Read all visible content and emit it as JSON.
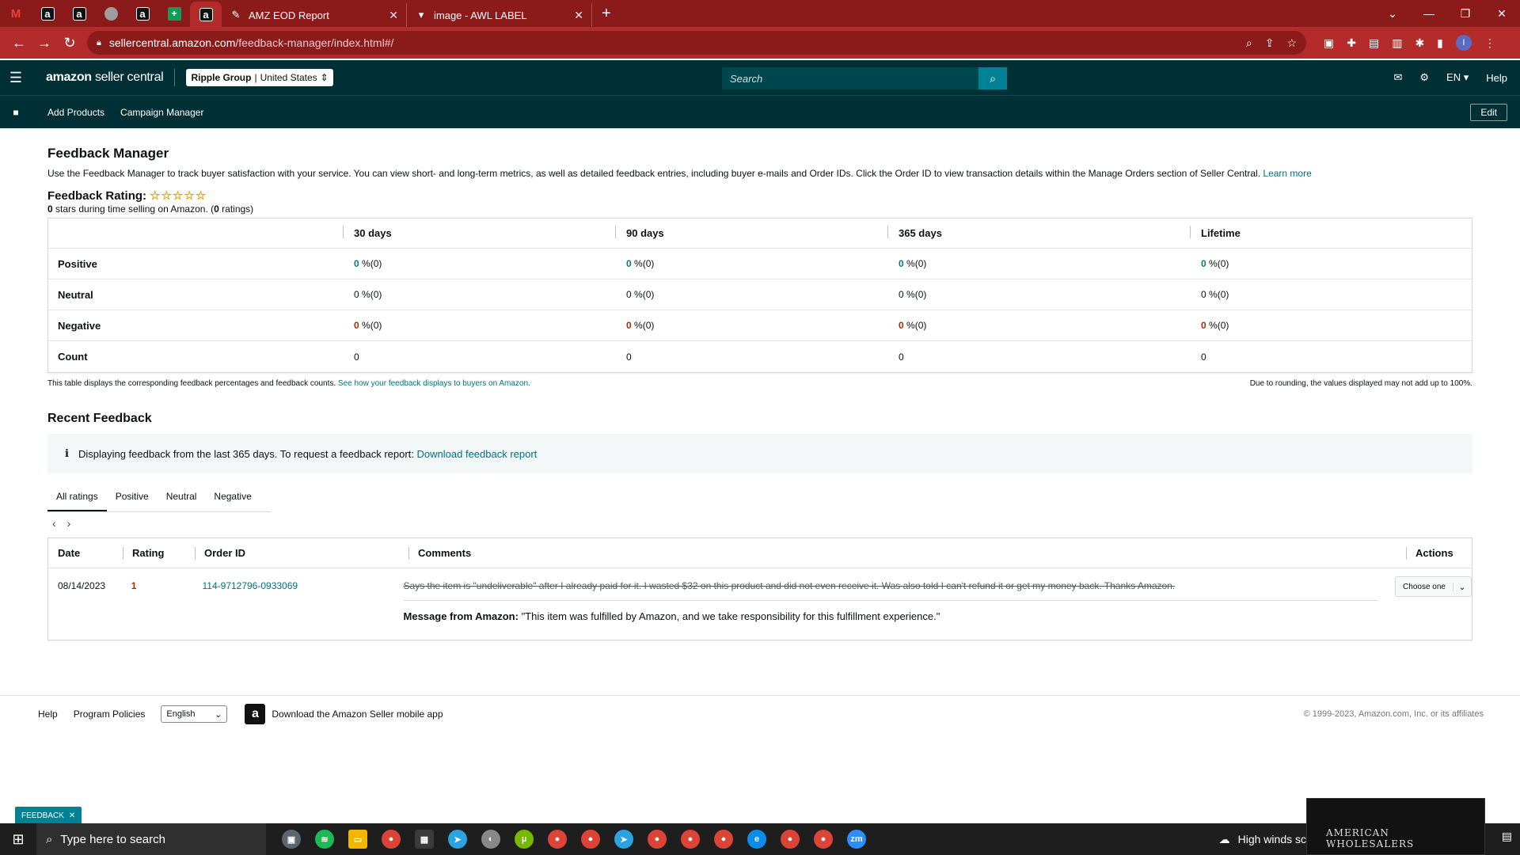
{
  "browser": {
    "tabs": [
      {
        "title": "AMZ EOD Report"
      },
      {
        "title": "image - AWL LABEL"
      }
    ],
    "url_host": "sellercentral.amazon.com",
    "url_path": "/feedback-manager/index.html#/"
  },
  "header": {
    "logo_main": "amazon",
    "logo_sub": "seller central",
    "account_name": "Ripple Group",
    "account_region": "United States",
    "search_placeholder": "Search",
    "lang": "EN",
    "help": "Help"
  },
  "subnav": {
    "links": [
      "Add Products",
      "Campaign Manager"
    ],
    "edit": "Edit"
  },
  "page": {
    "title": "Feedback Manager",
    "intro": "Use the Feedback Manager to track buyer satisfaction with your service. You can view short- and long-term metrics, as well as detailed feedback entries, including buyer e-mails and Order IDs. Click the Order ID to view transaction details within the Manage Orders section of Seller Central.",
    "learn_more": "Learn more",
    "rating_label": "Feedback Rating:",
    "stars": "☆☆☆☆☆",
    "rating_count_stars": "0",
    "rating_sub_mid": " stars during time selling on Amazon. (",
    "rating_count": "0",
    "rating_sub_end": " ratings)"
  },
  "stats": {
    "columns": [
      "30 days",
      "90 days",
      "365 days",
      "Lifetime"
    ],
    "rows": [
      {
        "label": "Positive",
        "cells": [
          {
            "num": "0",
            "rest": " %(0)"
          },
          {
            "num": "0",
            "rest": " %(0)"
          },
          {
            "num": "0",
            "rest": " %(0)"
          },
          {
            "num": "0",
            "rest": " %(0)"
          }
        ]
      },
      {
        "label": "Neutral",
        "cells": [
          {
            "num": "0",
            "rest": " %(0)"
          },
          {
            "num": "0",
            "rest": " %(0)"
          },
          {
            "num": "0",
            "rest": " %(0)"
          },
          {
            "num": "0",
            "rest": " %(0)"
          }
        ]
      },
      {
        "label": "Negative",
        "cells": [
          {
            "num": "0",
            "rest": " %(0)"
          },
          {
            "num": "0",
            "rest": " %(0)"
          },
          {
            "num": "0",
            "rest": " %(0)"
          },
          {
            "num": "0",
            "rest": " %(0)"
          }
        ]
      },
      {
        "label": "Count",
        "cells": [
          "0",
          "0",
          "0",
          "0"
        ]
      }
    ],
    "note_left": "This table displays the corresponding feedback percentages and feedback counts.",
    "note_link": "See how your feedback displays to buyers on Amazon.",
    "note_right": "Due to rounding, the values displayed may not add up to 100%."
  },
  "recent": {
    "title": "Recent Feedback",
    "info_text": "Displaying feedback from the last 365 days. To request a feedback report:",
    "info_link": "Download feedback report",
    "tabs": [
      "All ratings",
      "Positive",
      "Neutral",
      "Negative"
    ],
    "columns": [
      "Date",
      "Rating",
      "Order ID",
      "Comments",
      "Actions"
    ],
    "entry": {
      "date": "08/14/2023",
      "rating": "1",
      "order_id": "114-9712796-0933069",
      "comment": "Says the item is \"undeliverable\" after I already paid for it. I wasted $32 on this product and did not even receive it. Was also told I can't refund it or get my money back. Thanks Amazon.",
      "msg_label": "Message from Amazon:",
      "msg_text": " \"This item was fulfilled by Amazon, and we take responsibility for this fulfillment experience.\"",
      "action": "Choose one"
    }
  },
  "footer": {
    "help": "Help",
    "policies": "Program Policies",
    "language": "English",
    "app": "Download the Amazon Seller mobile app",
    "copyright": "© 1999-2023, Amazon.com, Inc. or its affiliates"
  },
  "feedback_pill": "FEEDBACK",
  "taskbar": {
    "search_placeholder": "Type here to search",
    "weather": "High winds sc",
    "video_caption": "AMERICAN WHOLESALERS"
  },
  "colors": {
    "header_bg": "#002f36",
    "browser_red": "#b32b2b",
    "positive_green": "#067d62",
    "negative_red": "#b12704",
    "link_teal": "#007185"
  }
}
